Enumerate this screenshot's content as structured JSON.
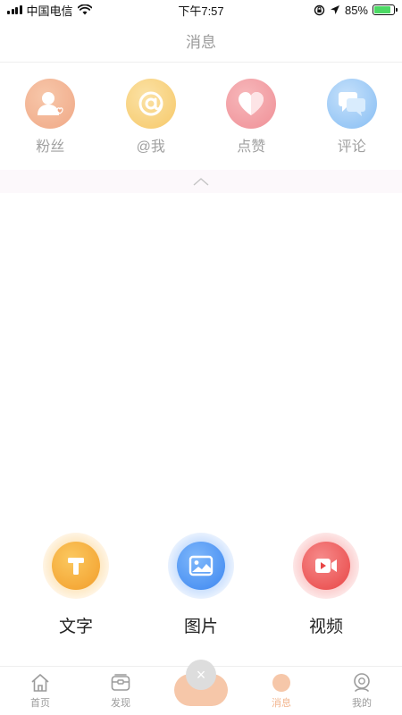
{
  "status_bar": {
    "carrier": "中国电信",
    "time": "下午7:57",
    "battery": "85%",
    "battery_level": 0.85
  },
  "header": {
    "title": "消息"
  },
  "categories": [
    {
      "label": "粉丝",
      "icon": "fans-icon",
      "color": "#f2b28f"
    },
    {
      "label": "@我",
      "icon": "at-icon",
      "color": "#f8d47f"
    },
    {
      "label": "点赞",
      "icon": "heart-icon",
      "color": "#f19aa0"
    },
    {
      "label": "评论",
      "icon": "comment-icon",
      "color": "#8ec4f5"
    }
  ],
  "collapse": {
    "icon": "chevron-up-icon"
  },
  "publish_options": [
    {
      "label": "文字",
      "icon": "text-icon",
      "color": "#f5ad3c"
    },
    {
      "label": "图片",
      "icon": "image-icon",
      "color": "#4b97f5"
    },
    {
      "label": "视频",
      "icon": "video-icon",
      "color": "#ef5a5a"
    }
  ],
  "tabs": [
    {
      "label": "首页",
      "icon": "home-icon"
    },
    {
      "label": "发现",
      "icon": "discover-icon"
    },
    {
      "label": "消息",
      "icon": "message-icon",
      "active": true
    },
    {
      "label": "我的",
      "icon": "profile-icon"
    }
  ],
  "center_button": {
    "glyph": "×"
  }
}
